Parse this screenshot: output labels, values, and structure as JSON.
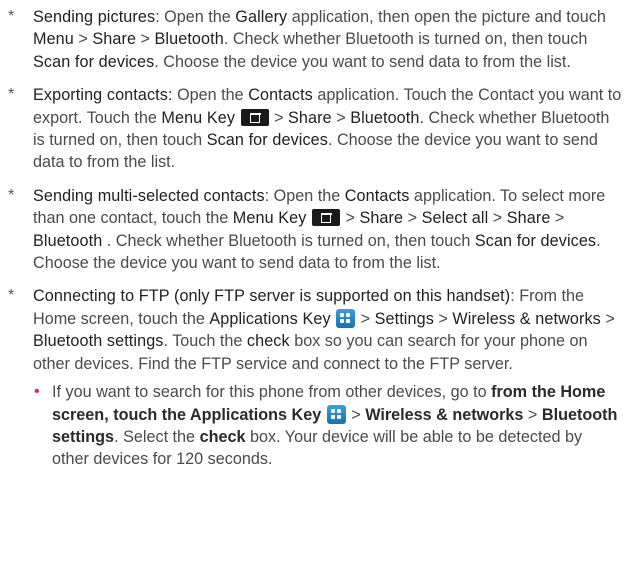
{
  "items": [
    {
      "bullet": "*",
      "s1": "Sending pictures",
      "s2": ": Open the ",
      "s3": "Gallery",
      "s4": " application, then open the picture and touch ",
      "s5": "Menu",
      "s6": " > ",
      "s7": "Share",
      "s8": " > ",
      "s9": "Bluetooth",
      "s10": ". Check whether Bluetooth is turned on, then touch ",
      "s11": "Scan for devices",
      "s12": ". Choose the device you want to send data to from the list."
    },
    {
      "bullet": "*",
      "s1": "Exporting contacts:",
      "s2": " Open the ",
      "s3": "Contacts",
      "s4": " application. Touch the Contact you want to export. Touch the ",
      "s5": "Menu Key",
      "s6": " > ",
      "s7": "Share",
      "s8": " > ",
      "s9": "Bluetooth",
      "s10": ". Check whether Bluetooth is turned on, then touch ",
      "s11": "Scan for devices",
      "s12": ". Choose the device you want to send data to from the list."
    },
    {
      "bullet": "*",
      "s1": "Sending multi-selected contacts",
      "s2": ": Open the ",
      "s3": "Contacts",
      "s4": " application. To select more than one contact, touch the ",
      "s5": "Menu Key",
      "s6": " > ",
      "s7": "Share",
      "s8": " > ",
      "s9": "Select all",
      "s10": " > ",
      "s11": "Share",
      "s12": " > ",
      "s13": "Bluetooth",
      "s14": " . Check whether Bluetooth is turned on, then touch ",
      "s15": "Scan for devices",
      "s16": ". Choose the device you want to send data to from the list."
    },
    {
      "bullet": "*",
      "s1": "Connecting to FTP (only FTP server is supported on this handset)",
      "s2": ": From the Home screen, touch the ",
      "s3": "Applications Key",
      "s4": " > ",
      "s5": "Settings",
      "s6": " > ",
      "s7": "Wireless & networks",
      "s8": " > ",
      "s9": "Bluetooth settings",
      "s10": ". Touch the ",
      "s11": "check",
      "s12": " box so you can search for your phone on other devices. Find the FTP service and connect to the FTP server."
    }
  ],
  "sub_item": {
    "bullet": "•",
    "s1": "If you want to search for this phone from other devices, go to ",
    "s2": "from the Home screen, touch the Applications Key",
    "s3": " > ",
    "s4": "Wireless & networks",
    "s5": " > ",
    "s6": "Bluetooth settings",
    "s7": ". Select the ",
    "s8": "check",
    "s9": " box. Your device will be able to be detected by other devices for 120 seconds."
  },
  "icons": {
    "menu_key": "menu-key-icon",
    "applications_key": "applications-key-icon"
  },
  "colors": {
    "body_text": "#4a4a4a",
    "emphasis_text": "#1f1f1f",
    "sub_bullet": "#e0245e",
    "apps_icon_top": "#3aa0d8",
    "apps_icon_bottom": "#1b6fb0",
    "menu_icon": "#1a1a1a"
  }
}
